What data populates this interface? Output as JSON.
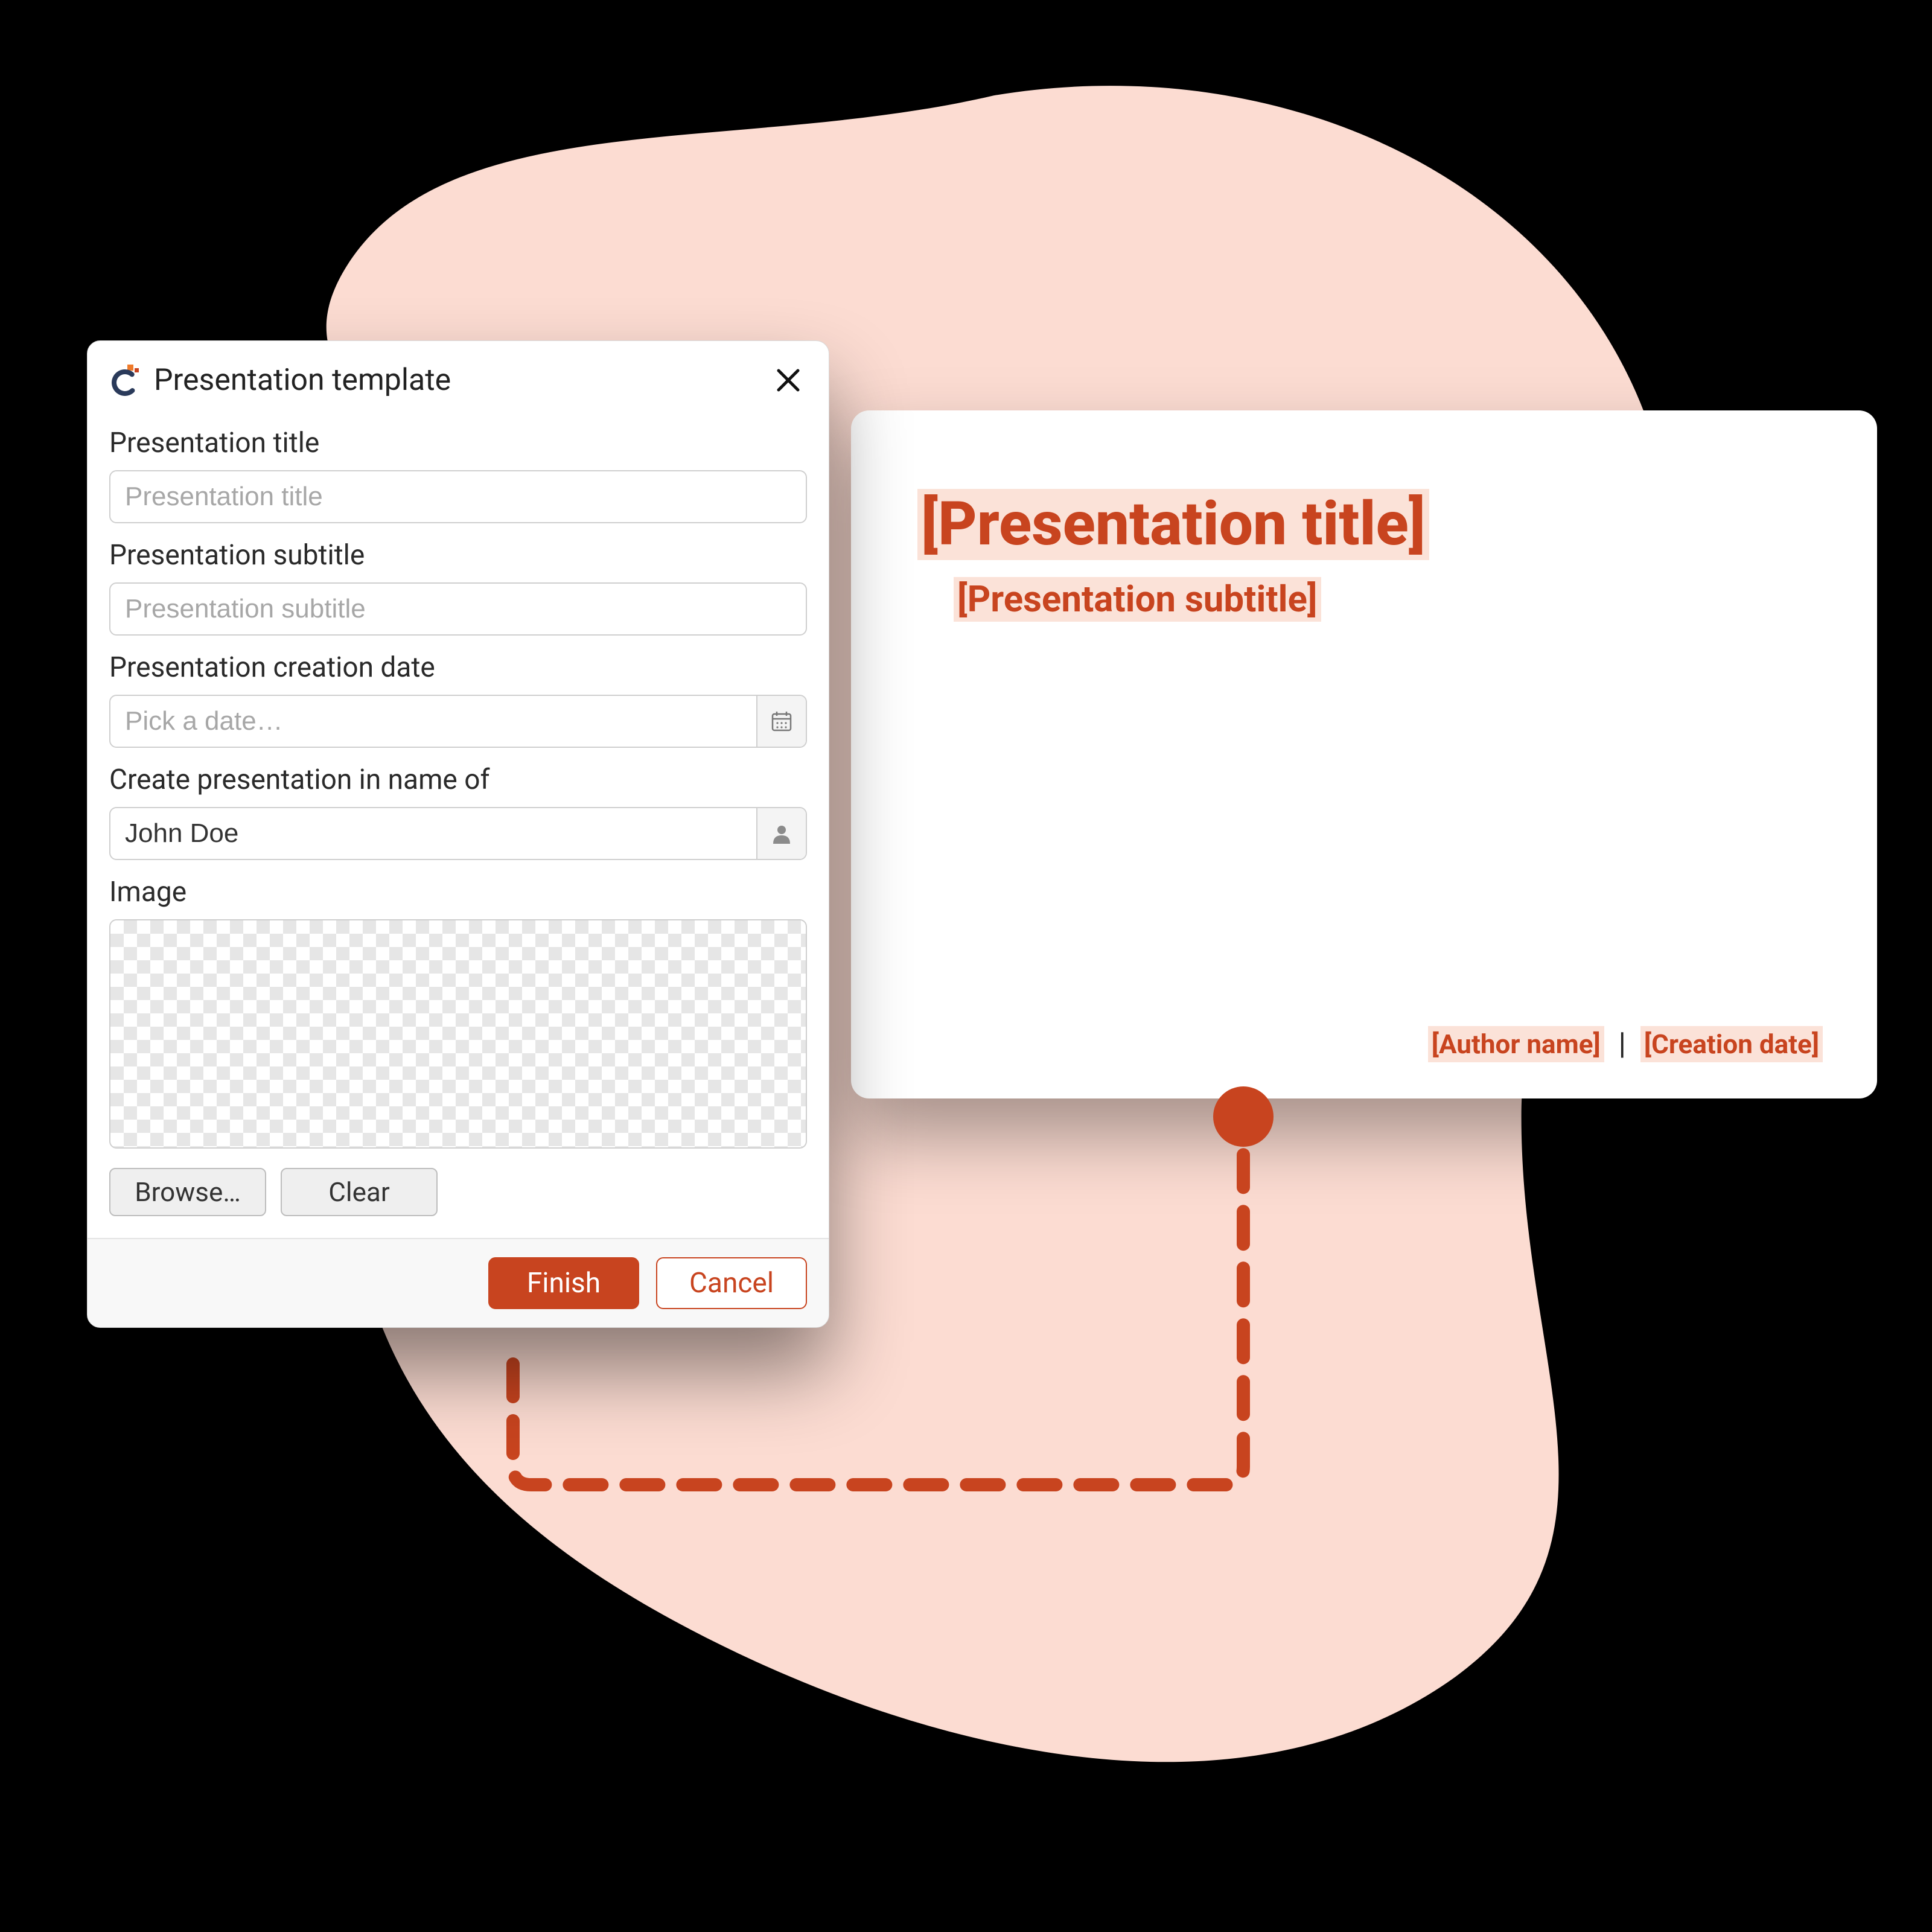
{
  "colors": {
    "accent": "#c8441f",
    "highlight": "#fbe2d8"
  },
  "dialog": {
    "title": "Presentation template",
    "fields": {
      "title_label": "Presentation title",
      "title_placeholder": "Presentation title",
      "subtitle_label": "Presentation subtitle",
      "subtitle_placeholder": "Presentation subtitle",
      "date_label": "Presentation creation date",
      "date_placeholder": "Pick a date…",
      "author_label": "Create presentation in name of",
      "author_value": "John Doe",
      "image_label": "Image"
    },
    "image_buttons": {
      "browse": "Browse…",
      "clear": "Clear"
    },
    "actions": {
      "finish": "Finish",
      "cancel": "Cancel"
    }
  },
  "slide": {
    "title": "Presentation title",
    "subtitle": "Presentation subtitle",
    "author": "Author name",
    "date": "Creation date"
  }
}
